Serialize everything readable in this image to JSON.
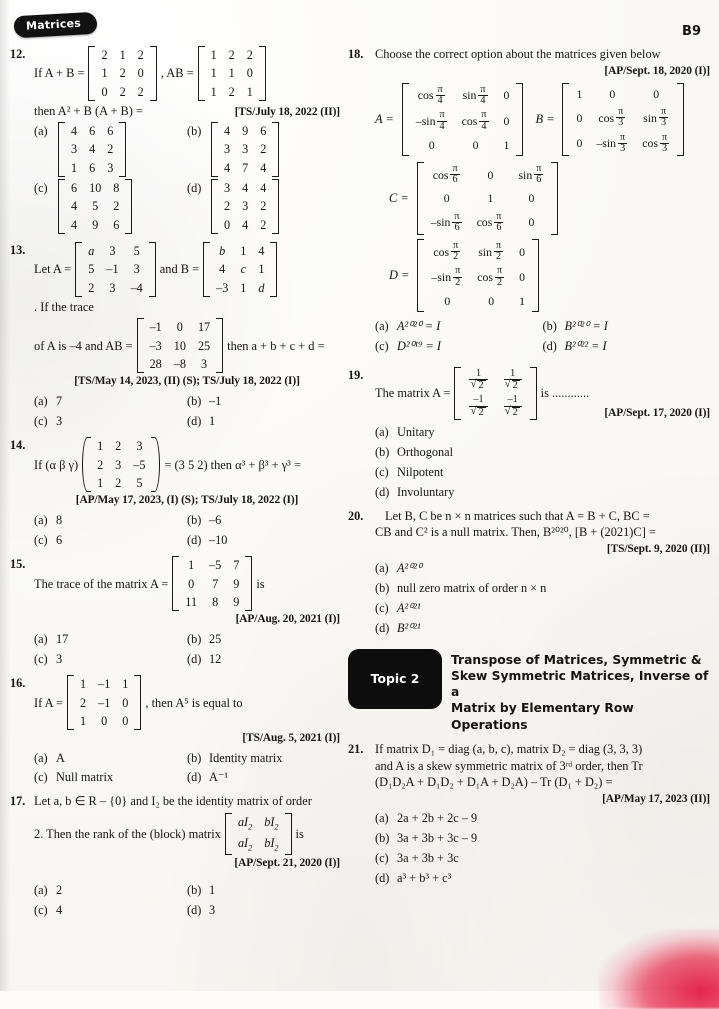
{
  "header": {
    "chapter_tab": "Matrices",
    "page_number": "B9"
  },
  "questions": [
    {
      "number": "12.",
      "stem_prefix": "If A + B =",
      "stem_mid": ", AB =",
      "stem_line2": "then A² + B (A + B) =",
      "source": "[TS/July 18, 2022 (II)]",
      "matrix_apb": [
        [
          "2",
          "1",
          "2"
        ],
        [
          "1",
          "2",
          "0"
        ],
        [
          "0",
          "2",
          "2"
        ]
      ],
      "matrix_ab": [
        [
          "1",
          "2",
          "2"
        ],
        [
          "1",
          "1",
          "0"
        ],
        [
          "1",
          "2",
          "1"
        ]
      ],
      "options": [
        {
          "label": "(a)",
          "matrix": [
            [
              "4",
              "6",
              "6"
            ],
            [
              "3",
              "4",
              "2"
            ],
            [
              "1",
              "6",
              "3"
            ]
          ]
        },
        {
          "label": "(b)",
          "matrix": [
            [
              "4",
              "9",
              "6"
            ],
            [
              "3",
              "3",
              "2"
            ],
            [
              "4",
              "7",
              "4"
            ]
          ]
        },
        {
          "label": "(c)",
          "matrix": [
            [
              "6",
              "10",
              "8"
            ],
            [
              "4",
              "5",
              "2"
            ],
            [
              "4",
              "9",
              "6"
            ]
          ]
        },
        {
          "label": "(d)",
          "matrix": [
            [
              "3",
              "4",
              "4"
            ],
            [
              "2",
              "3",
              "2"
            ],
            [
              "0",
              "4",
              "2"
            ]
          ]
        }
      ]
    },
    {
      "number": "13.",
      "stem_a": "Let A =",
      "stem_b": "and B =",
      "stem_c": ". If the trace",
      "stem_d": "of A is –4 and AB =",
      "stem_e": "then a + b + c + d =",
      "source": "[TS/May 14, 2023, (II) (S); TS/July 18, 2022 (I)]",
      "matrix_A": [
        [
          "a",
          "3",
          "5"
        ],
        [
          "5",
          "–1",
          "3"
        ],
        [
          "2",
          "3",
          "–4"
        ]
      ],
      "matrix_B": [
        [
          "b",
          "1",
          "4"
        ],
        [
          "4",
          "c",
          "1"
        ],
        [
          "–3",
          "1",
          "d"
        ]
      ],
      "matrix_AB": [
        [
          "–1",
          "0",
          "17"
        ],
        [
          "–3",
          "10",
          "25"
        ],
        [
          "28",
          "–8",
          "3"
        ]
      ],
      "options": [
        {
          "label": "(a)",
          "text": "7"
        },
        {
          "label": "(b)",
          "text": "–1"
        },
        {
          "label": "(c)",
          "text": "3"
        },
        {
          "label": "(d)",
          "text": "1"
        }
      ]
    },
    {
      "number": "14.",
      "stem_a": "If (α β γ)",
      "stem_b": "= (3  5  2) then α³ + β³ + γ³ =",
      "source": "[AP/May 17, 2023, (I) (S); TS/July 18, 2022 (I)]",
      "matrix": [
        [
          "1",
          "2",
          "3"
        ],
        [
          "2",
          "3",
          "–5"
        ],
        [
          "1",
          "2",
          "5"
        ]
      ],
      "options": [
        {
          "label": "(a)",
          "text": "8"
        },
        {
          "label": "(b)",
          "text": "–6"
        },
        {
          "label": "(c)",
          "text": "6"
        },
        {
          "label": "(d)",
          "text": "–10"
        }
      ]
    },
    {
      "number": "15.",
      "stem_a": "The trace of the matrix A =",
      "stem_b": "is",
      "source": "[AP/Aug. 20, 2021 (I)]",
      "matrix": [
        [
          "1",
          "–5",
          "7"
        ],
        [
          "0",
          "7",
          "9"
        ],
        [
          "11",
          "8",
          "9"
        ]
      ],
      "options": [
        {
          "label": "(a)",
          "text": "17"
        },
        {
          "label": "(b)",
          "text": "25"
        },
        {
          "label": "(c)",
          "text": "3"
        },
        {
          "label": "(d)",
          "text": "12"
        }
      ]
    },
    {
      "number": "16.",
      "stem_a": "If A =",
      "stem_b": ", then A⁵ is equal to",
      "source": "[TS/Aug. 5, 2021 (I)]",
      "matrix": [
        [
          "1",
          "–1",
          "1"
        ],
        [
          "2",
          "–1",
          "0"
        ],
        [
          "1",
          "0",
          "0"
        ]
      ],
      "options": [
        {
          "label": "(a)",
          "text": "A"
        },
        {
          "label": "(b)",
          "text": "Identity matrix"
        },
        {
          "label": "(c)",
          "text": "Null matrix"
        },
        {
          "label": "(d)",
          "text": "A⁻¹"
        }
      ]
    },
    {
      "number": "17.",
      "stem_a": "Let a, b ∈ R – {0} and I₂ be the identity matrix of order",
      "stem_b": "2. Then the rank of the (block) matrix",
      "stem_c": "is",
      "source": "[AP/Sept. 21, 2020 (I)]",
      "matrix": [
        [
          "aI₂",
          "bI₂"
        ],
        [
          "aI₂",
          "bI₂"
        ]
      ],
      "options": [
        {
          "label": "(a)",
          "text": "2"
        },
        {
          "label": "(b)",
          "text": "1"
        },
        {
          "label": "(c)",
          "text": "4"
        },
        {
          "label": "(d)",
          "text": "3"
        }
      ]
    },
    {
      "number": "18.",
      "stem": "Choose the correct option about the matrices given below",
      "source": "[AP/Sept. 18, 2020 (I)]",
      "matrix_A_label": "A =",
      "matrix_B_label": "B =",
      "matrix_C_label": "C =",
      "matrix_D_label": "D =",
      "options": [
        {
          "label": "(a)",
          "text": "A²⁰²⁰ = I"
        },
        {
          "label": "(b)",
          "text": "B²⁰²⁰ = I"
        },
        {
          "label": "(c)",
          "text": "D²⁰¹⁹ = I"
        },
        {
          "label": "(d)",
          "text": "B²⁰²² = I"
        }
      ]
    },
    {
      "number": "19.",
      "stem_a": "The matrix A =",
      "stem_b": "is ............",
      "source": "[AP/Sept. 17, 2020 (I)]",
      "options": [
        {
          "label": "(a)",
          "text": "Unitary"
        },
        {
          "label": "(b)",
          "text": "Orthogonal"
        },
        {
          "label": "(c)",
          "text": "Nilpotent"
        },
        {
          "label": "(d)",
          "text": "Involuntary"
        }
      ]
    },
    {
      "number": "20.",
      "stem_a": "Let B, C be n × n matrices such that A = B + C, BC =",
      "stem_b": "CB and C² is a null matrix. Then, B²⁰²⁰, [B + (2021)C] =",
      "source": "[TS/Sept. 9, 2020 (II)]",
      "options": [
        {
          "label": "(a)",
          "text": "A²⁰²⁰"
        },
        {
          "label": "(b)",
          "text": "null zero matrix of order n × n"
        },
        {
          "label": "(c)",
          "text": "A²⁰²¹"
        },
        {
          "label": "(d)",
          "text": "B²⁰²¹"
        }
      ]
    },
    {
      "number": "21.",
      "stem_a": "If matrix D₁ = diag (a, b, c), matrix D₂ = diag (3, 3, 3)",
      "stem_b": "and A is a skew symmetric matrix of 3ʳᵈ order, then Tr",
      "stem_c": "(D₁D₂A + D₁D₂ + D₁A + D₂A) – Tr (D₁ + D₂) =",
      "source": "[AP/May 17, 2023 (II)]",
      "options": [
        {
          "label": "(a)",
          "text": "2a + 2b + 2c – 9"
        },
        {
          "label": "(b)",
          "text": "3a + 3b + 3c – 9"
        },
        {
          "label": "(c)",
          "text": "3a + 3b + 3c"
        },
        {
          "label": "(d)",
          "text": "a³ + b³ + c³"
        }
      ]
    }
  ],
  "topic": {
    "badge": "Topic 2",
    "title_line1": "Transpose of Matrices, Symmetric &",
    "title_line2": "Skew Symmetric Matrices, Inverse of a",
    "title_line3": "Matrix by Elementary Row Operations"
  },
  "symbols": {
    "pi": "π",
    "cos": "cos",
    "sin": "sin",
    "neg_sin": "–sin",
    "one": "1",
    "zero": "0",
    "two": "2",
    "three": "3",
    "four": "4",
    "six": "6",
    "neg_one": "–1"
  }
}
